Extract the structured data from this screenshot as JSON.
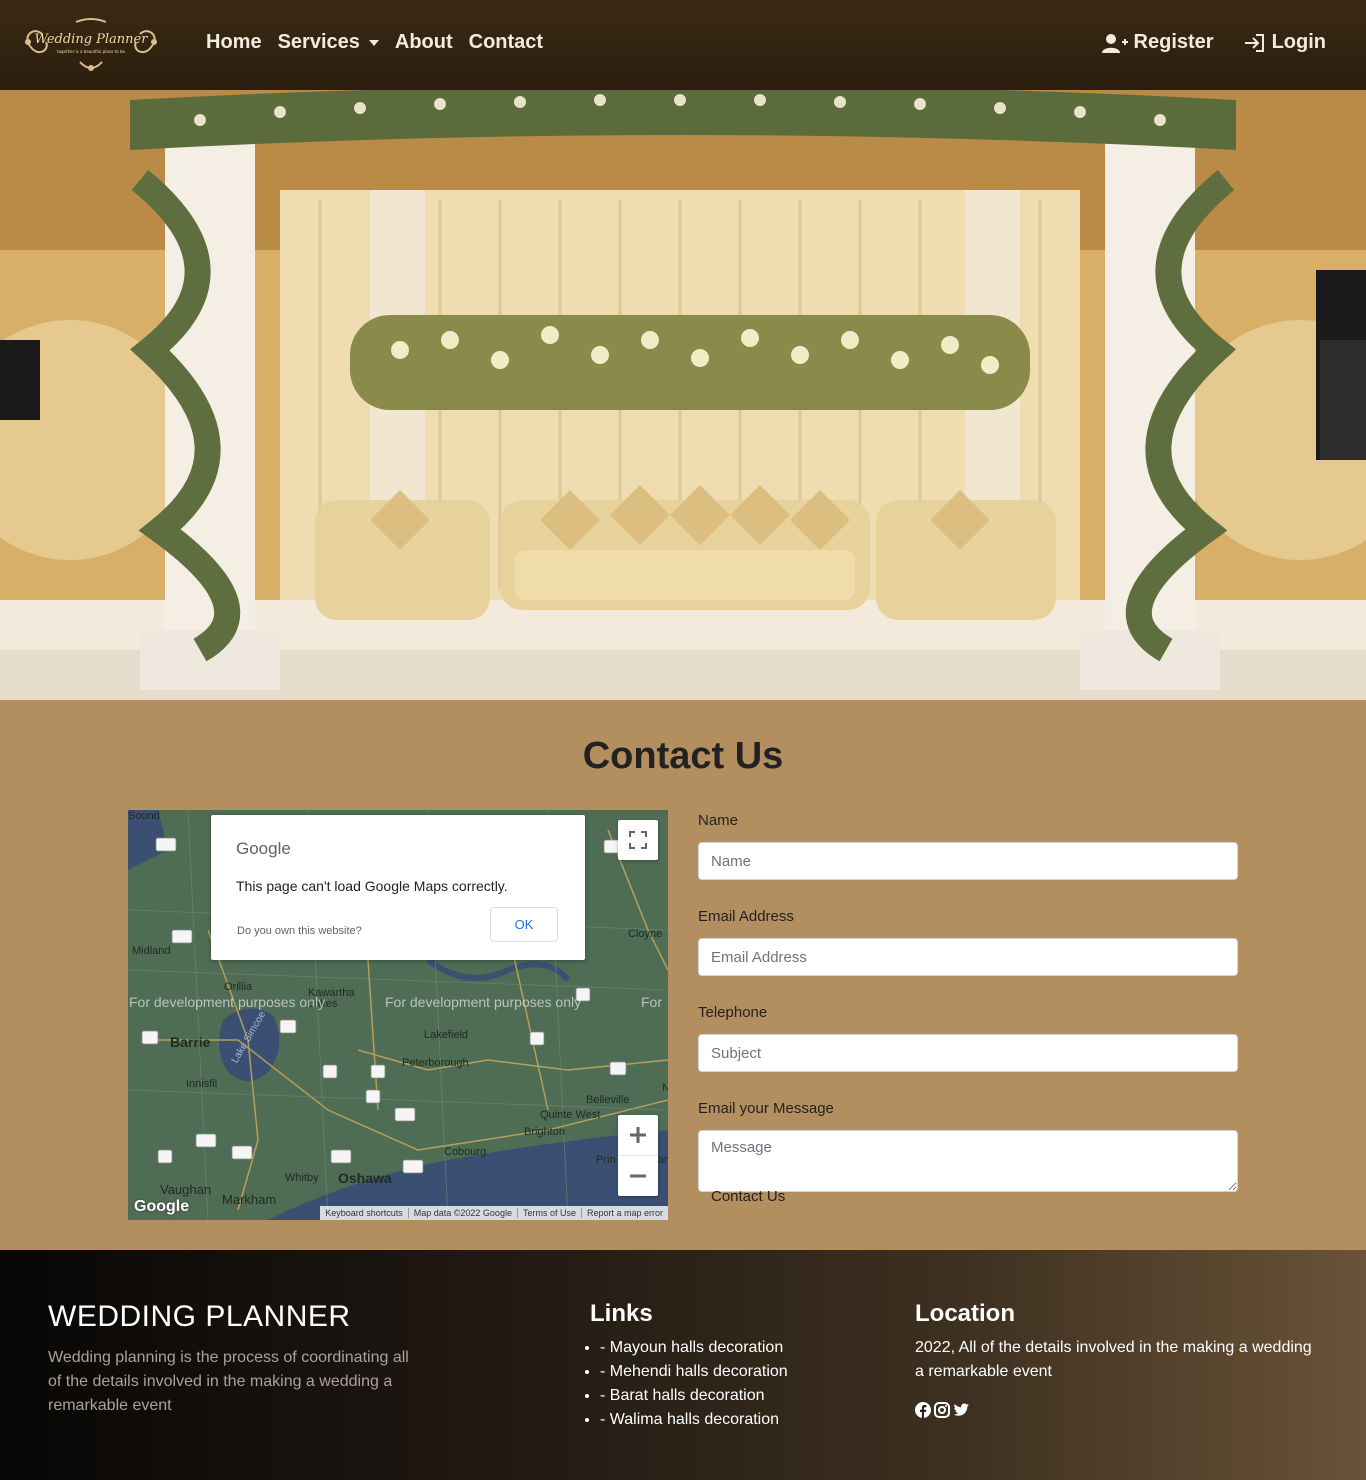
{
  "navbar": {
    "logo_text": "Wedding Planner",
    "logo_tagline": "together is a beautiful place to be",
    "links": [
      "Home",
      "Services",
      "About",
      "Contact"
    ],
    "register": "Register",
    "login": "Login"
  },
  "contact": {
    "title": "Contact Us",
    "map": {
      "dialog_logo": "Google",
      "dialog_message": "This page can't load Google Maps correctly.",
      "dialog_own": "Do you own this website?",
      "dialog_ok": "OK",
      "dev_text": "For development purposes only",
      "dev_text_short": "For",
      "places": [
        "Sound",
        "Midland",
        "Orillia",
        "Kawartha Lakes",
        "Barrie",
        "Lake Simcoe",
        "Lakefield",
        "Peterborough",
        "Innisfil",
        "Belleville",
        "Quinte West",
        "Brighton",
        "Cobourg",
        "Cloyne",
        "Vaughan",
        "Markham",
        "Whitby",
        "Oshawa",
        "Prin",
        "ar",
        "N"
      ],
      "footer": [
        "Keyboard shortcuts",
        "Map data ©2022 Google",
        "Terms of Use",
        "Report a map error"
      ],
      "google_mark": "Google"
    },
    "form": {
      "name_label": "Name",
      "name_placeholder": "Name",
      "email_label": "Email Address",
      "email_placeholder": "Email Address",
      "phone_label": "Telephone",
      "phone_placeholder": "Subject",
      "message_label": "Email your Message",
      "message_placeholder": "Message",
      "submit": "Contact Us"
    }
  },
  "footer": {
    "brand": "WEDDING PLANNER",
    "description": "Wedding planning is the process of coordinating all of the details involved in the making a wedding a remarkable event",
    "links_title": "Links",
    "links": [
      "- Mayoun halls decoration",
      "- Mehendi halls decoration",
      "- Barat halls decoration",
      "- Walima halls decoration"
    ],
    "location_title": "Location",
    "location_text": "2022, All of the details involved in the making a wedding a remarkable event",
    "socials": [
      "facebook-icon",
      "instagram-icon",
      "twitter-icon"
    ]
  },
  "colors": {
    "page_bg": "#b38f60",
    "navbar_bg": "#2b1e0e",
    "map_link_blue": "#1a73e8"
  }
}
